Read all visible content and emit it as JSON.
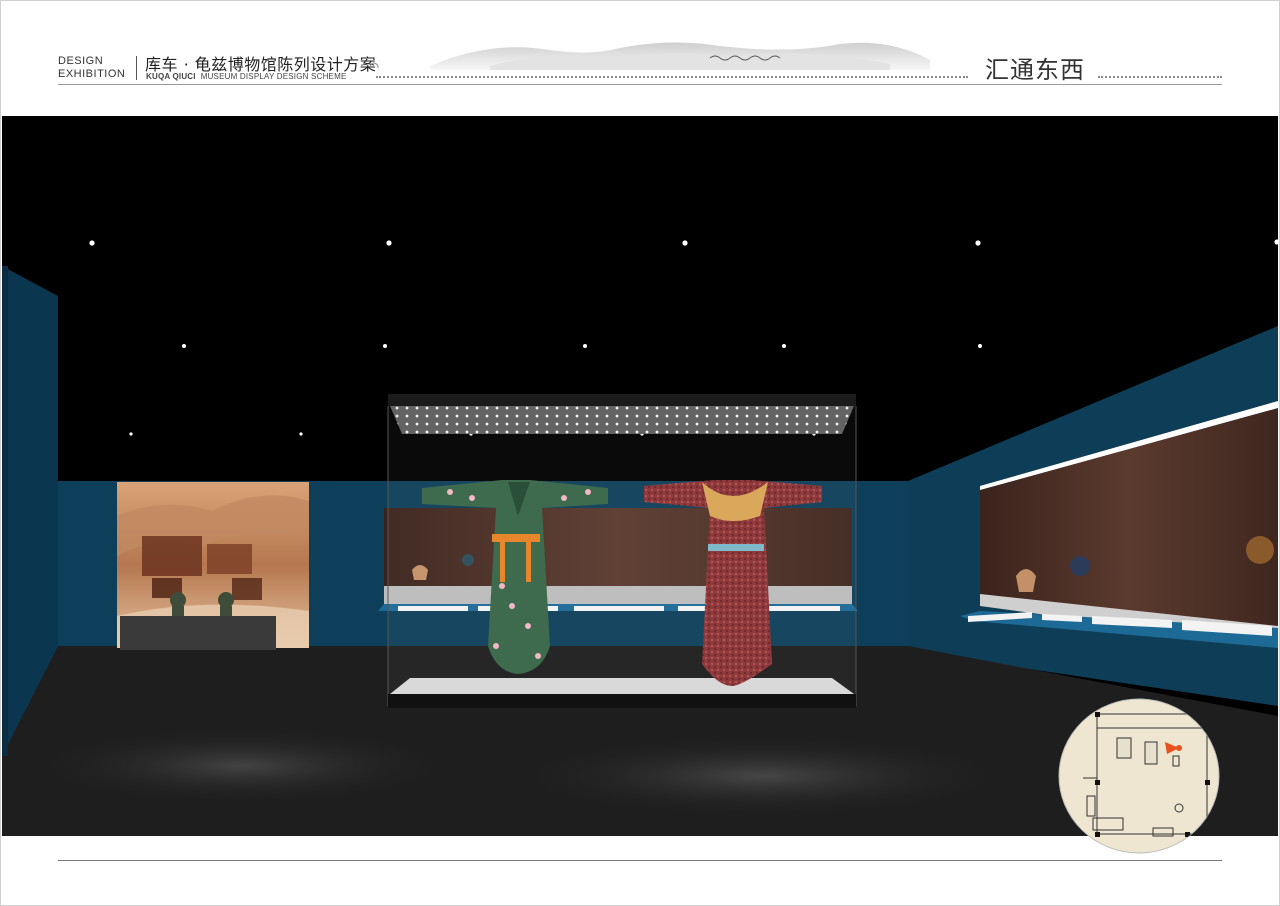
{
  "header": {
    "brand_line1": "DESIGN",
    "brand_line2": "EXHIBITION",
    "title_cn": "库车 · 龟兹博物馆陈列设计方案",
    "subtitle_brand": "KUQA QIUCI",
    "subtitle_text": "MUSEUM DISPLAY DESIGN SCHEME",
    "section_title": "汇通东西"
  },
  "colors": {
    "wall_blue": "#0e3f5a",
    "floor": "#1c1c1c",
    "case_wood": "#4a2e25",
    "plan_bg": "#eee6d0",
    "marker": "#e8501c"
  },
  "icons": {
    "camera_marker": "location-cone-icon"
  }
}
